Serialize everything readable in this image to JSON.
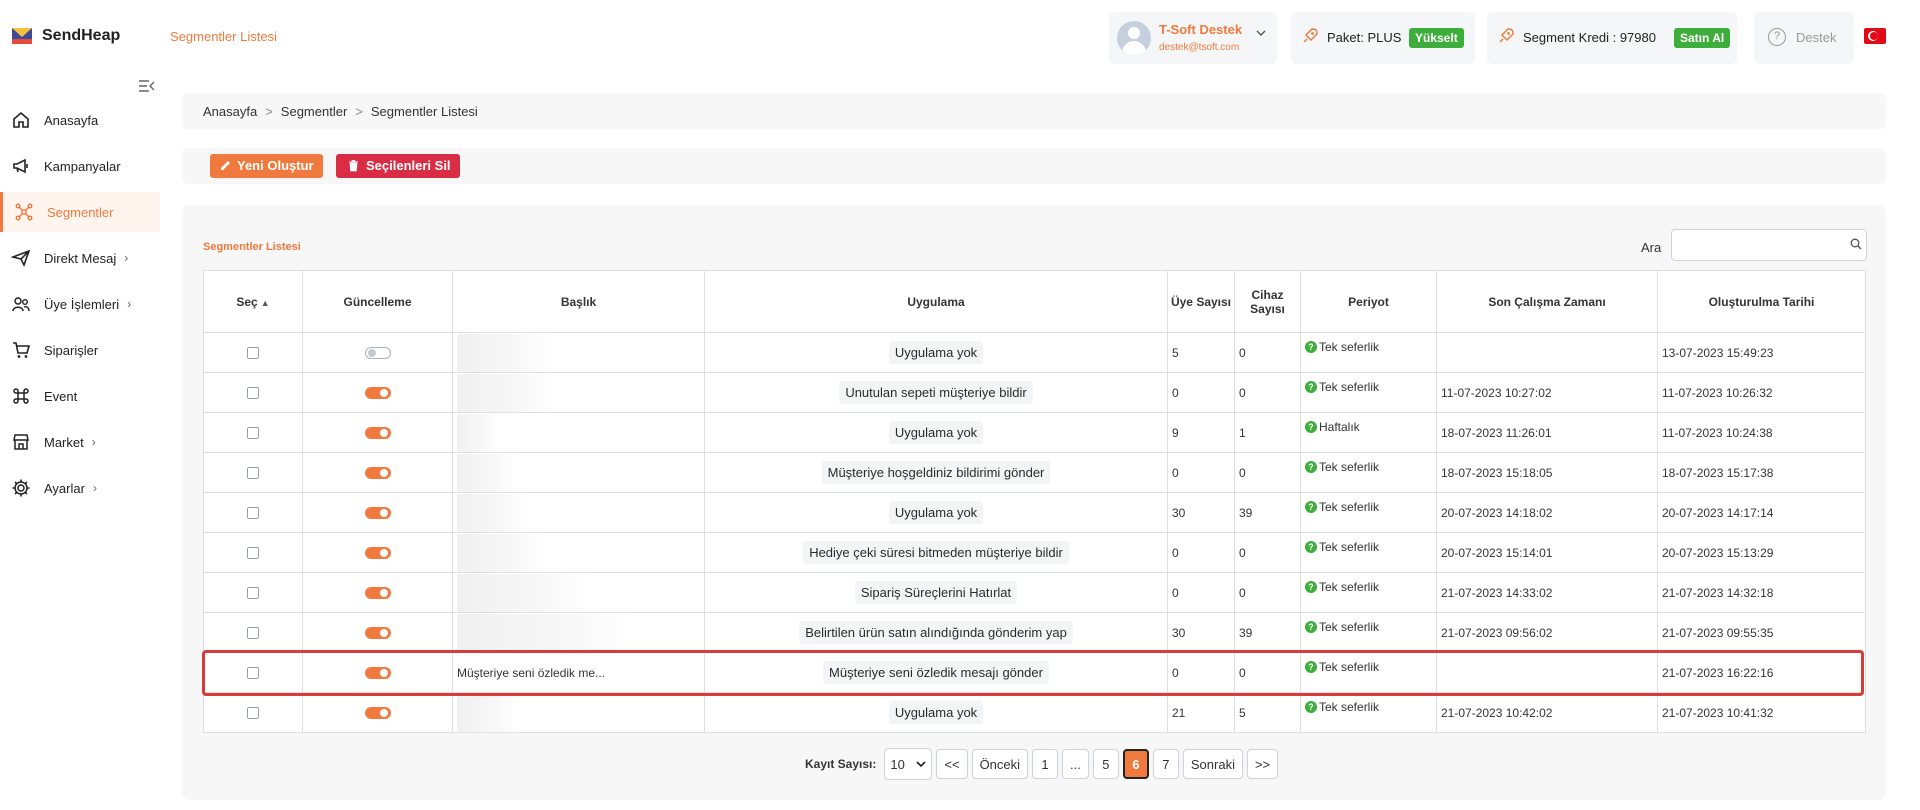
{
  "app": {
    "name": "SendHeap",
    "page_title": "Segmentler Listesi"
  },
  "header": {
    "user": {
      "name": "T-Soft Destek",
      "email": "destek@tsoft.com"
    },
    "package": {
      "label": "Paket: PLUS",
      "button": "Yükselt"
    },
    "credit": {
      "label": "Segment Kredi : 97980",
      "button": "Satın Al"
    },
    "support": "Destek",
    "language_flag": "turkey-flag"
  },
  "sidebar": {
    "items": [
      {
        "label": "Anasayfa",
        "icon": "home-icon",
        "has_children": false,
        "active": false
      },
      {
        "label": "Kampanyalar",
        "icon": "megaphone-icon",
        "has_children": false,
        "active": false
      },
      {
        "label": "Segmentler",
        "icon": "network-icon",
        "has_children": false,
        "active": true
      },
      {
        "label": "Direkt Mesaj",
        "icon": "paper-plane-icon",
        "has_children": true,
        "active": false
      },
      {
        "label": "Üye İşlemleri",
        "icon": "users-icon",
        "has_children": true,
        "active": false
      },
      {
        "label": "Siparişler",
        "icon": "cart-icon",
        "has_children": false,
        "active": false
      },
      {
        "label": "Event",
        "icon": "command-icon",
        "has_children": false,
        "active": false
      },
      {
        "label": "Market",
        "icon": "store-icon",
        "has_children": true,
        "active": false
      },
      {
        "label": "Ayarlar",
        "icon": "gear-icon",
        "has_children": true,
        "active": false
      }
    ]
  },
  "breadcrumb": [
    "Anasayfa",
    "Segmentler",
    "Segmentler Listesi"
  ],
  "actions": {
    "new_label": "Yeni Oluştur",
    "delete_label": "Seçilenleri Sil"
  },
  "list": {
    "title": "Segmentler Listesi",
    "search_label": "Ara",
    "search_value": "",
    "columns": [
      "Seç",
      "Güncelleme",
      "Başlık",
      "Uygulama",
      "Üye Sayısı",
      "Cihaz Sayısı",
      "Periyot",
      "Son Çalışma Zamanı",
      "Oluşturulma Tarihi"
    ],
    "rows": [
      {
        "update_on": false,
        "title": "",
        "blur_width": 95,
        "app": "Uygulama yok",
        "members": "5",
        "devices": "0",
        "period": "Tek seferlik",
        "last_run": "",
        "created": "13-07-2023 15:49:23",
        "highlighted": false
      },
      {
        "update_on": true,
        "title": "",
        "blur_width": 98,
        "app": "Unutulan sepeti müşteriye bildir",
        "members": "0",
        "devices": "0",
        "period": "Tek seferlik",
        "last_run": "11-07-2023 10:27:02",
        "created": "11-07-2023 10:26:32",
        "highlighted": false
      },
      {
        "update_on": true,
        "title": "",
        "blur_width": 40,
        "app": "Uygulama yok",
        "members": "9",
        "devices": "1",
        "period": "Haftalık",
        "last_run": "18-07-2023 11:26:01",
        "created": "11-07-2023 10:24:38",
        "highlighted": false
      },
      {
        "update_on": true,
        "title": "",
        "blur_width": 60,
        "app": "Müşteriye hoşgeldiniz bildirimi gönder",
        "members": "0",
        "devices": "0",
        "period": "Tek seferlik",
        "last_run": "18-07-2023 15:18:05",
        "created": "18-07-2023 15:17:38",
        "highlighted": false
      },
      {
        "update_on": true,
        "title": "",
        "blur_width": 70,
        "app": "Uygulama yok",
        "members": "30",
        "devices": "39",
        "period": "Tek seferlik",
        "last_run": "20-07-2023 14:18:02",
        "created": "20-07-2023 14:17:14",
        "highlighted": false
      },
      {
        "update_on": true,
        "title": "",
        "blur_width": 90,
        "app": "Hediye çeki süresi bitmeden müşteriye bildir",
        "members": "0",
        "devices": "0",
        "period": "Tek seferlik",
        "last_run": "20-07-2023 15:14:01",
        "created": "20-07-2023 15:13:29",
        "highlighted": false
      },
      {
        "update_on": true,
        "title": "",
        "blur_width": 135,
        "app": "Sipariş Süreçlerini Hatırlat",
        "members": "0",
        "devices": "0",
        "period": "Tek seferlik",
        "last_run": "21-07-2023 14:33:02",
        "created": "21-07-2023 14:32:18",
        "highlighted": false
      },
      {
        "update_on": true,
        "title": "",
        "blur_width": 175,
        "app": "Belirtilen ürün satın alındığında gönderim yap",
        "members": "30",
        "devices": "39",
        "period": "Tek seferlik",
        "last_run": "21-07-2023 09:56:02",
        "created": "21-07-2023 09:55:35",
        "highlighted": false
      },
      {
        "update_on": true,
        "title": "Müşteriye seni özledik me...",
        "blur_width": 0,
        "app": "Müşteriye seni özledik mesajı gönder",
        "members": "0",
        "devices": "0",
        "period": "Tek seferlik",
        "last_run": "",
        "created": "21-07-2023 16:22:16",
        "highlighted": true
      },
      {
        "update_on": true,
        "title": "",
        "blur_width": 60,
        "app": "Uygulama yok",
        "members": "21",
        "devices": "5",
        "period": "Tek seferlik",
        "last_run": "21-07-2023 10:42:02",
        "created": "21-07-2023 10:41:32",
        "highlighted": false
      }
    ]
  },
  "pagination": {
    "record_label": "Kayıt Sayısı:",
    "page_size": "10",
    "first": "<<",
    "prev": "Önceki",
    "pages": [
      "1",
      "...",
      "5",
      "6",
      "7"
    ],
    "current": "6",
    "next": "Sonraki",
    "last": ">>"
  },
  "colors": {
    "accent": "#f07a3d",
    "success": "#3dae3b",
    "danger": "#d92d45",
    "highlight": "#d93a3a"
  }
}
